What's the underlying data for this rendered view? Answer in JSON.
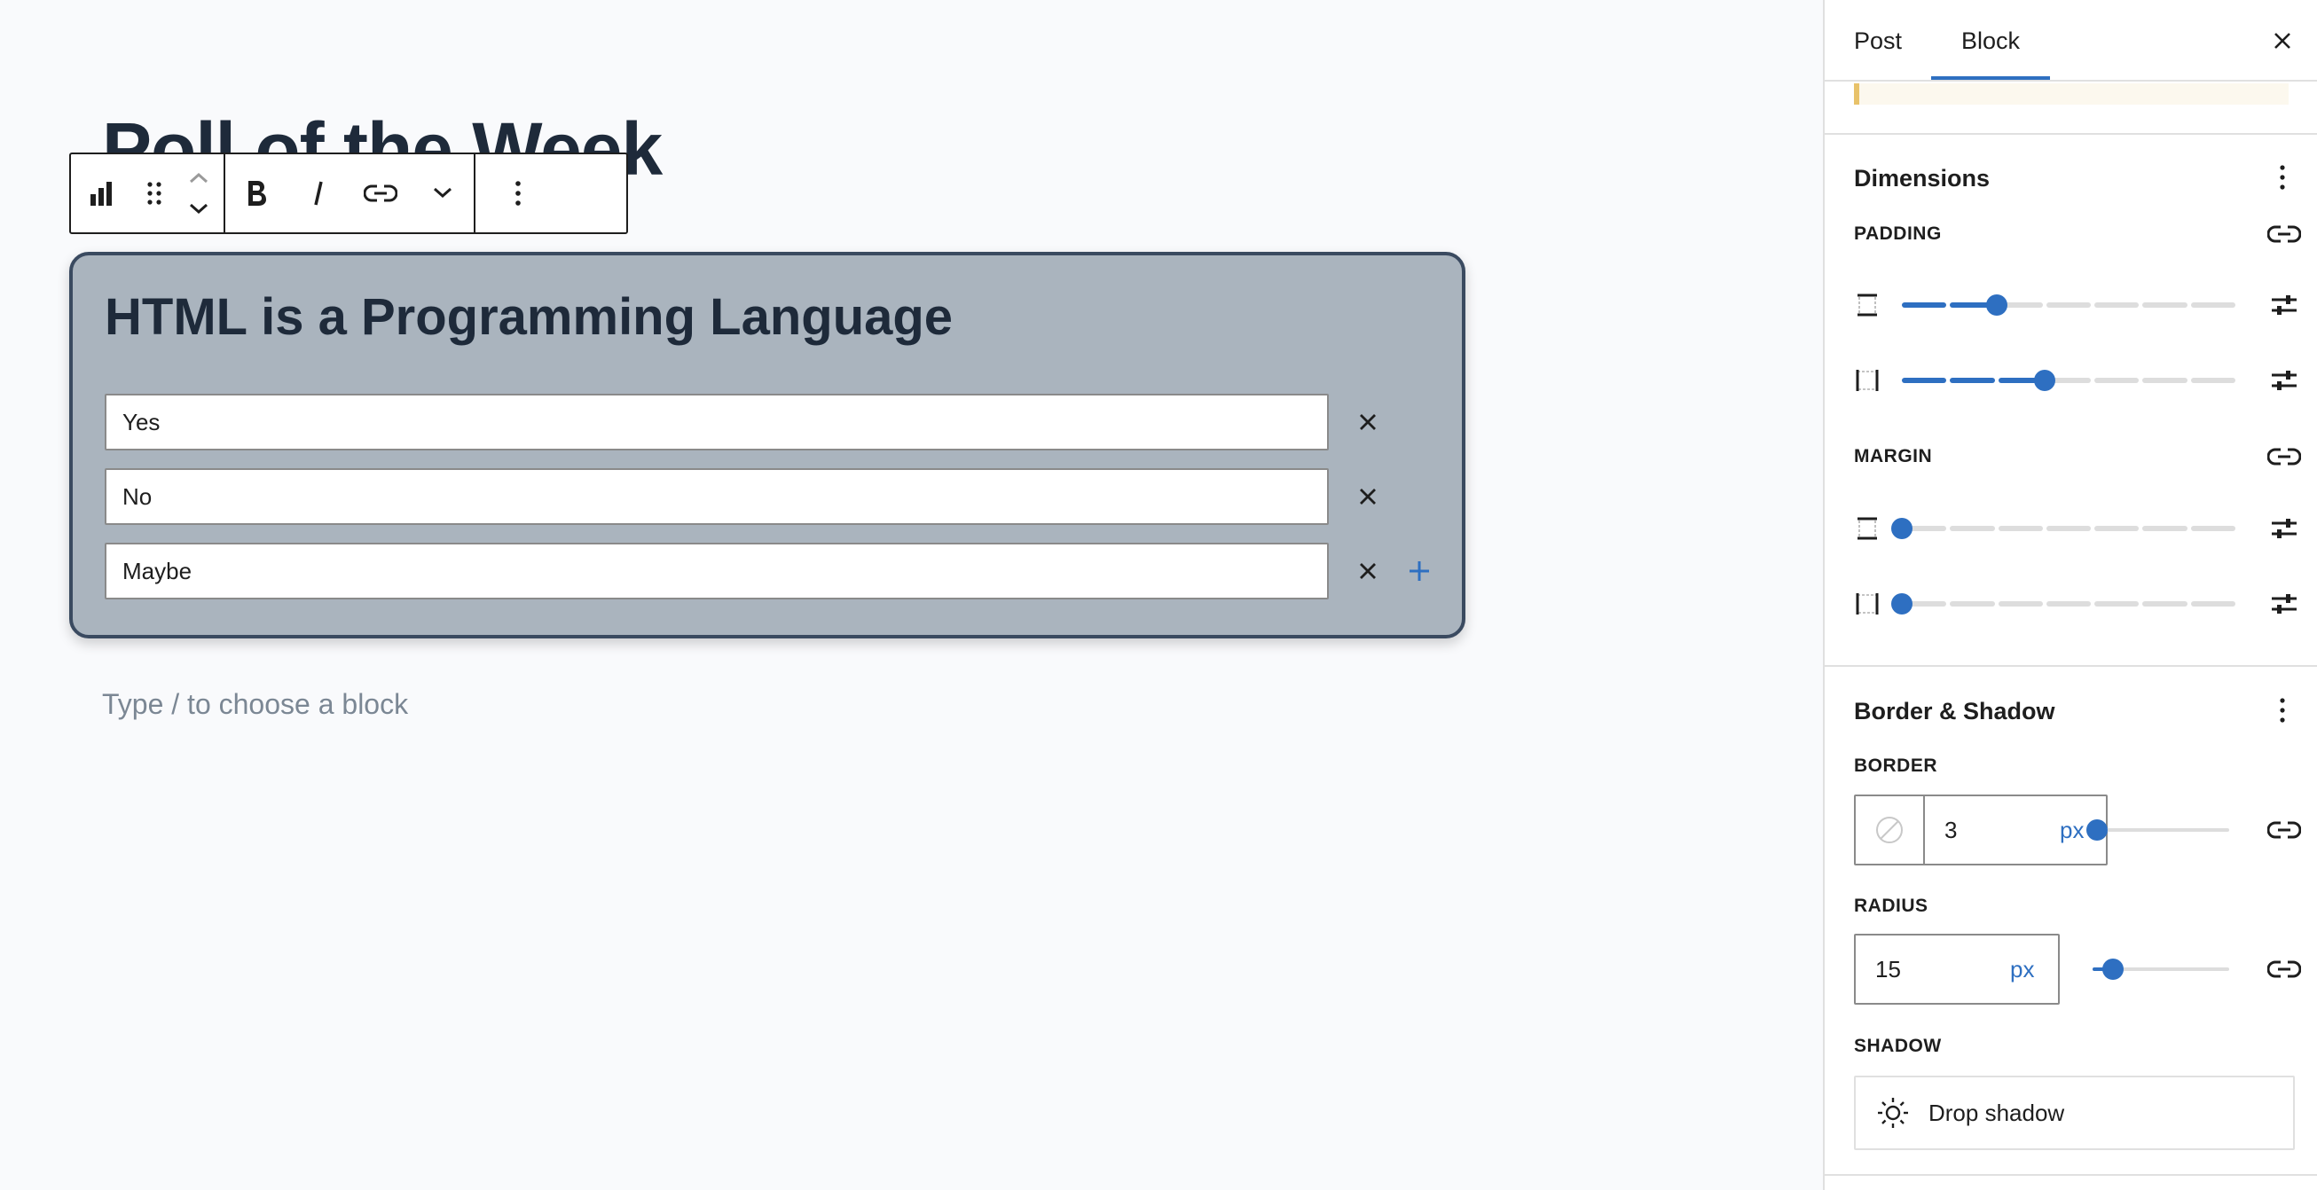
{
  "editor": {
    "post_title": "Poll of the Week",
    "poll": {
      "question": "HTML is a Programming Language",
      "options": [
        "Yes",
        "No",
        "Maybe"
      ]
    },
    "appender_placeholder": "Type / to choose a block"
  },
  "toolbar": {
    "icons": [
      "poll-block-icon",
      "drag-handle-icon",
      "move-up-icon",
      "move-down-icon",
      "bold-icon",
      "italic-icon",
      "link-icon",
      "chevron-down-icon",
      "more-options-icon"
    ]
  },
  "sidebar": {
    "tabs": [
      "Post",
      "Block"
    ],
    "active_tab": "Block",
    "dimensions": {
      "title": "Dimensions",
      "padding_label": "PADDING",
      "padding_vertical_step": 2,
      "padding_horizontal_step": 3,
      "margin_label": "MARGIN",
      "margin_vertical_step": 0,
      "margin_horizontal_step": 0,
      "step_count": 7
    },
    "border_shadow": {
      "title": "Border & Shadow",
      "border_label": "BORDER",
      "border_width": "3",
      "border_unit": "px",
      "border_slider_fraction": 0.03,
      "radius_label": "RADIUS",
      "radius_value": "15",
      "radius_unit": "px",
      "radius_slider_fraction": 0.15,
      "shadow_label": "SHADOW",
      "shadow_button": "Drop shadow"
    }
  },
  "colors": {
    "accent": "#2e6fc1",
    "poll_background": "#aab4be",
    "poll_border": "#3a4a60",
    "notice_accent": "#e8c26a"
  }
}
